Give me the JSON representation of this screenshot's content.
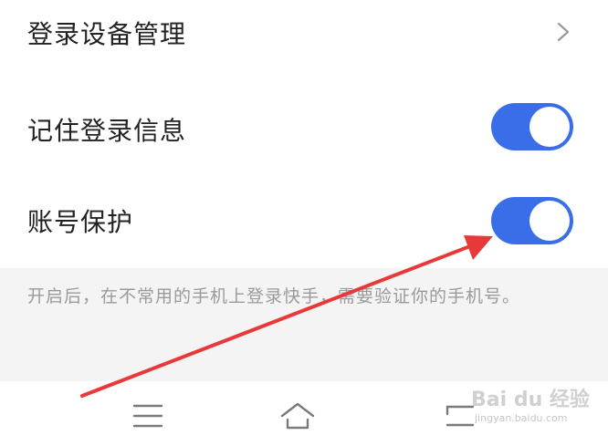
{
  "settings": {
    "devices_label": "登录设备管理",
    "remember_label": "记住登录信息",
    "remember_on": true,
    "protect_label": "账号保护",
    "protect_on": true,
    "protect_description": "开启后，在不常用的手机上登录快手，需要验证你的手机号。"
  },
  "navbar": {
    "menu_icon": "menu-icon",
    "home_icon": "home-icon",
    "back_icon": "back-icon"
  },
  "colors": {
    "toggle_on": "#3a6ee8",
    "annotation_arrow": "#e8393a",
    "description_bg": "#f4f4f4"
  },
  "watermark": {
    "logo": "Bai du 经验",
    "url": "jingyan.baidu.com"
  }
}
